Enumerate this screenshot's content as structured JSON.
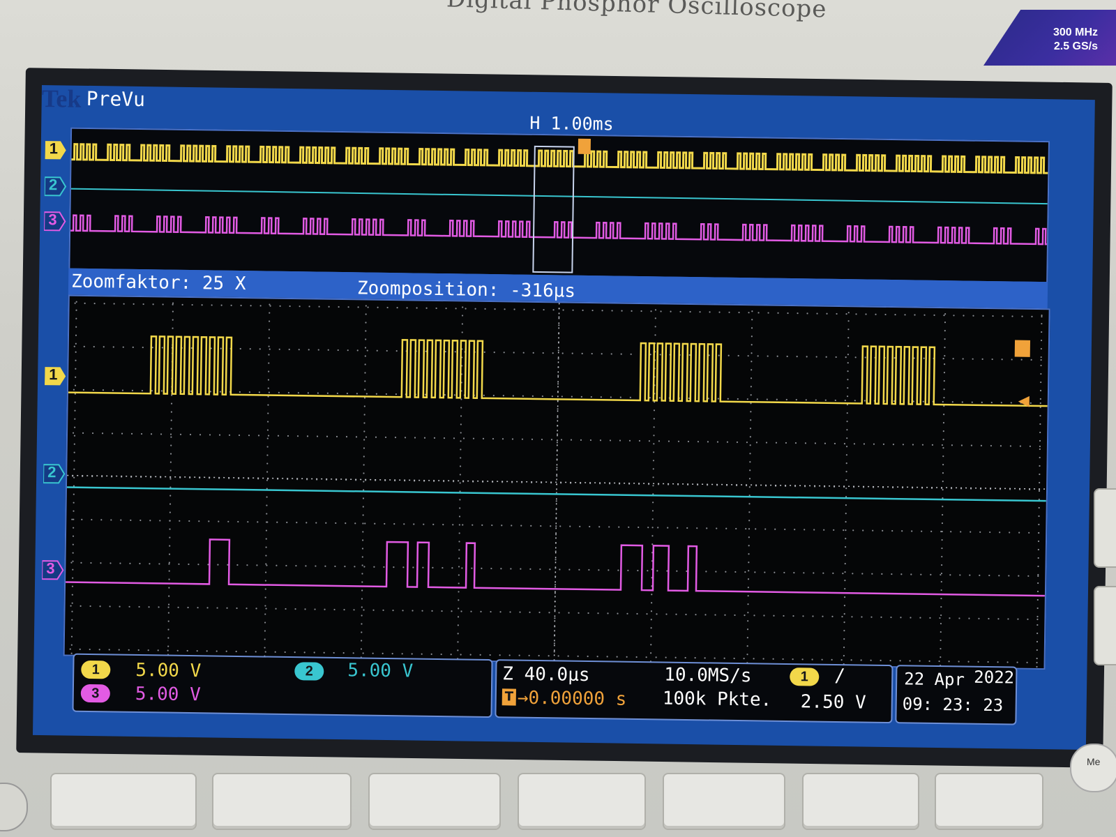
{
  "device": {
    "brand_text": "Digital Phosphor Oscilloscope",
    "spec_bandwidth": "300 MHz",
    "spec_samplerate": "2.5 GS/s"
  },
  "screen": {
    "logo": "Tek",
    "mode": "PreVu",
    "horizontal_scale": "H 1.00ms",
    "zoom_factor": "Zoomfaktor: 25 X",
    "zoom_position": "Zoomposition: -316µs"
  },
  "channels": [
    {
      "id": "1",
      "color": "#f2d84a"
    },
    {
      "id": "2",
      "color": "#39c6d0"
    },
    {
      "id": "3",
      "color": "#e25be4"
    }
  ],
  "status": {
    "ch1_scale": "5.00 V",
    "ch2_scale": "5.00 V",
    "ch3_scale": "5.00 V",
    "zoom_timebase": "Z 40.0µs",
    "trigger_pos": "→0.00000 s",
    "sample_rate": "10.0MS/s",
    "record_length": "100k Pkte.",
    "trigger_level": "2.50 V",
    "date": "22 Apr",
    "year": "2022",
    "time": "09: 23: 23"
  },
  "icons": {
    "trigger_marker": "T",
    "edge_icon": "/",
    "side_arrow": "←"
  }
}
